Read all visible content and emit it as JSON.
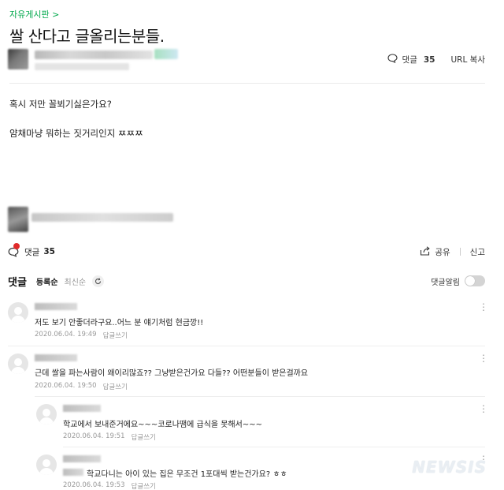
{
  "board_link": "자유게시판 >",
  "post": {
    "title": "쌀 산다고 글올리는분들.",
    "comment_label": "댓글",
    "comment_count": "35",
    "url_copy": "URL 복사",
    "body_lines": [
      "혹시 저만 꼴뵈기싫은가요?",
      "얌채마냥 뭐하는 짓거리인지 ㅉㅉㅉ"
    ]
  },
  "bar": {
    "comment_label": "댓글",
    "comment_count": "35",
    "share": "공유",
    "report": "신고"
  },
  "comments_header": {
    "title": "댓글",
    "sort_register": "등록순",
    "sort_latest": "최신순",
    "alarm": "댓글알림"
  },
  "comments": [
    {
      "text": "저도 보기 안좋더라구요..어느 분 얘기처럼 현금깡!!",
      "date": "2020.06.04. 19:49",
      "reply": "답글쓰기"
    },
    {
      "text": "근데 쌀을 파는사람이 왜이리많죠?? 그냥받은건가요 다들?? 어떤분들이 받은걸까요",
      "date": "2020.06.04. 19:50",
      "reply": "답글쓰기"
    },
    {
      "text": "학교에서 보내준거에요~~~코로나땜에 급식을 못해서~~~",
      "date": "2020.06.04. 19:51",
      "reply": "답글쓰기"
    },
    {
      "text": "학교다니는 아이 있는 집은 무조건 1포대씩 받는건가요? ㅎㅎ",
      "date": "2020.06.04. 19:53",
      "reply": "답글쓰기"
    }
  ],
  "watermark": "NEWSIS",
  "icons": {
    "comment": "speech-bubble-icon",
    "share": "share-icon",
    "refresh": "refresh-icon",
    "more": "kebab-menu-icon"
  },
  "colors": {
    "accent_green": "#03a94d",
    "badge_red": "#e02a2a"
  }
}
